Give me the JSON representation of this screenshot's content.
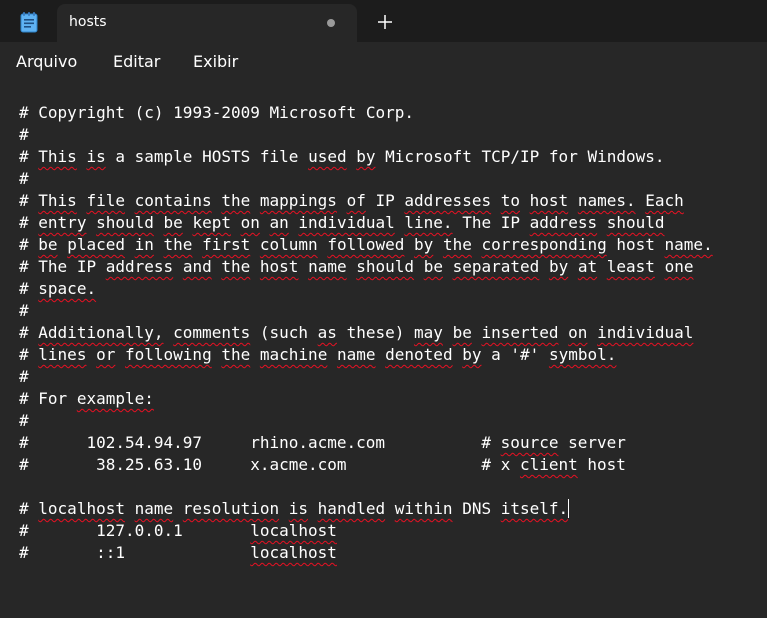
{
  "tab": {
    "title": "hosts"
  },
  "new_tab_symbol": "+",
  "menu": {
    "file": "Arquivo",
    "edit": "Editar",
    "view": "Exibir"
  },
  "editor": {
    "lines": [
      "# Copyright (c) 1993-2009 Microsoft Corp.",
      "#",
      "# This is a sample HOSTS file used by Microsoft TCP/IP for Windows.",
      "#",
      "# This file contains the mappings of IP addresses to host names. Each",
      "# entry should be kept on an individual line. The IP address should",
      "# be placed in the first column followed by the corresponding host name.",
      "# The IP address and the host name should be separated by at least one",
      "# space.",
      "#",
      "# Additionally, comments (such as these) may be inserted on individual",
      "# lines or following the machine name denoted by a '#' symbol.",
      "#",
      "# For example:",
      "#",
      "#      102.54.94.97     rhino.acme.com          # source server",
      "#       38.25.63.10     x.acme.com              # x client host",
      "",
      "# localhost name resolution is handled within DNS itself.",
      "#\t127.0.0.1       localhost",
      "#\t::1             localhost"
    ],
    "spellcheck_words": [
      [],
      [],
      [
        "This",
        "is",
        "used",
        "by"
      ],
      [],
      [
        "This",
        "file",
        "contains",
        "the",
        "mappings",
        "of",
        "addresses",
        "to",
        "host",
        "names.",
        "Each"
      ],
      [
        "entry",
        "should",
        "be",
        "kept",
        "on",
        "an",
        "individual",
        "line.",
        "address",
        "should"
      ],
      [
        "be",
        "placed",
        "in",
        "the",
        "first",
        "column",
        "followed",
        "by",
        "the",
        "corresponding",
        "name."
      ],
      [
        "address",
        "and",
        "the",
        "host",
        "name",
        "should",
        "be",
        "separated",
        "by",
        "at",
        "least",
        "one"
      ],
      [
        "space."
      ],
      [],
      [
        "Additionally,",
        "comments",
        "such",
        "as",
        "these",
        "may",
        "be",
        "inserted",
        "on",
        "individual"
      ],
      [
        "lines",
        "or",
        "following",
        "the",
        "machine",
        "name",
        "denoted",
        "by",
        "symbol."
      ],
      [],
      [
        "example:"
      ],
      [],
      [
        "source"
      ],
      [
        "client"
      ],
      [],
      [
        "localhost",
        "name",
        "resolution",
        "is",
        "handled",
        "within",
        "itself."
      ],
      [
        "localhost"
      ],
      [
        "localhost"
      ]
    ],
    "caret_line": 18,
    "tab_size": 8
  }
}
